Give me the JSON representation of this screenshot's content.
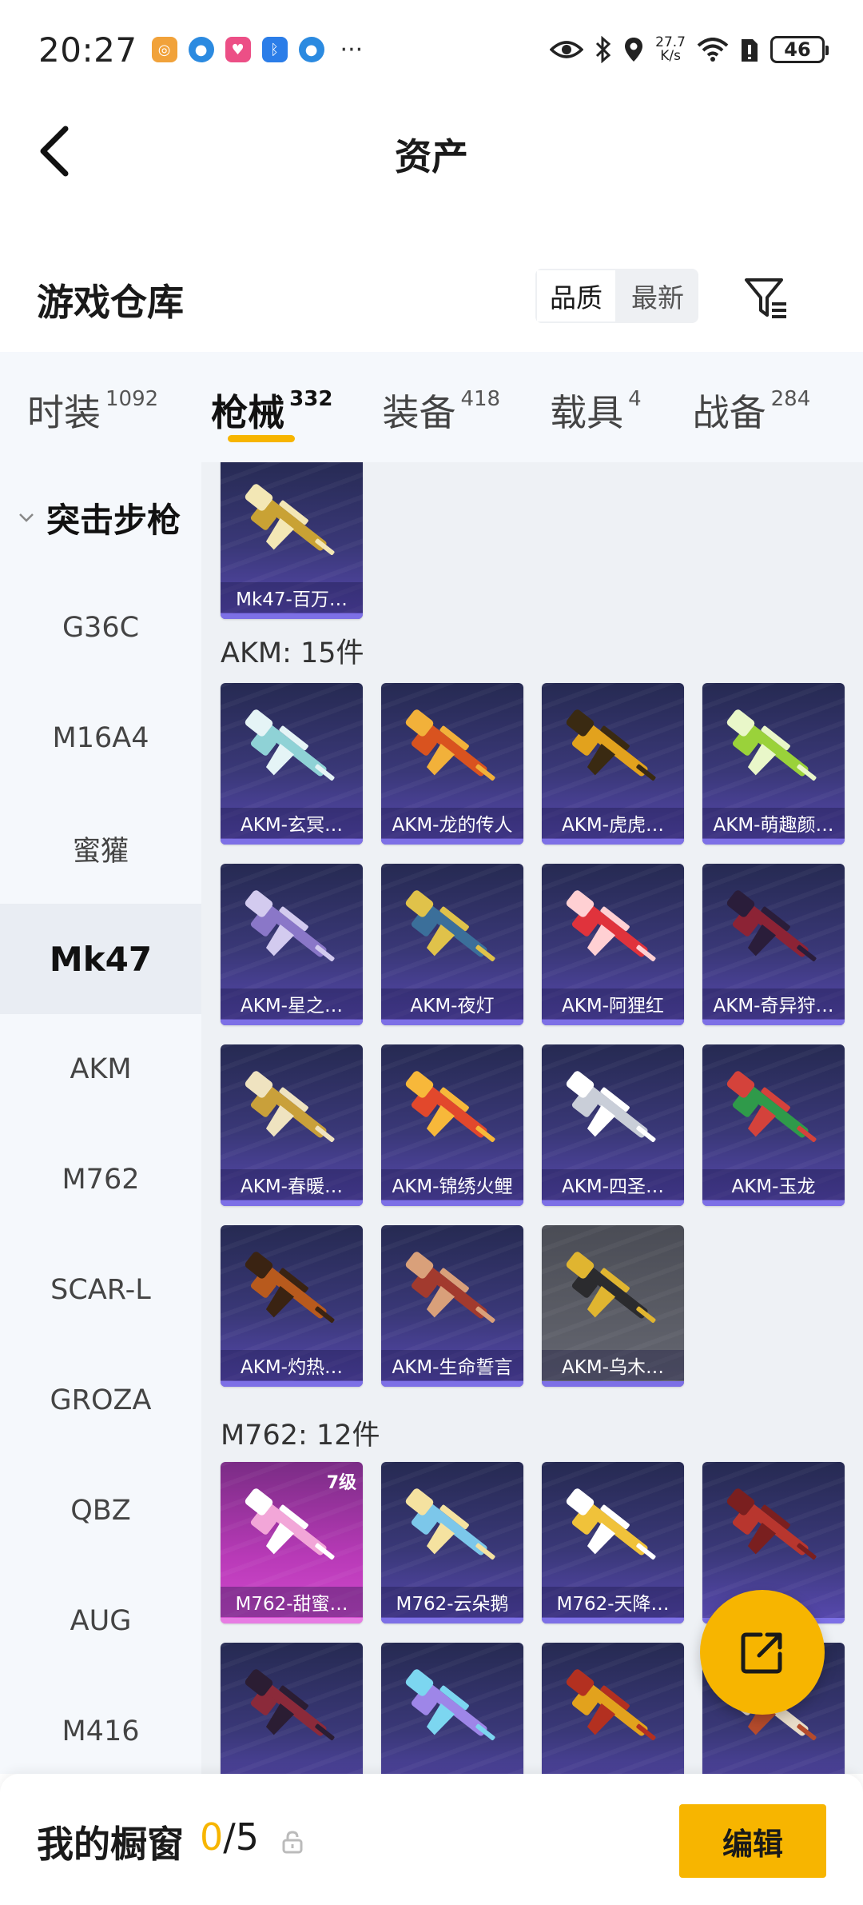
{
  "status_bar": {
    "time": "20:27",
    "net_speed_value": "27.7",
    "net_speed_unit": "K/s",
    "battery": "46",
    "dots": "···"
  },
  "header": {
    "title": "资产"
  },
  "section": {
    "title": "游戏仓库",
    "sort_options": [
      "品质",
      "最新"
    ],
    "active_sort": "品质"
  },
  "tabs": [
    {
      "label": "时装",
      "count": "1092"
    },
    {
      "label": "枪械",
      "count": "332",
      "active": true
    },
    {
      "label": "装备",
      "count": "418"
    },
    {
      "label": "载具",
      "count": "4"
    },
    {
      "label": "战备",
      "count": "284"
    }
  ],
  "categories": {
    "group": "突击步枪",
    "items": [
      "G36C",
      "M16A4",
      "蜜獾",
      "Mk47",
      "AKM",
      "M762",
      "SCAR-L",
      "GROZA",
      "QBZ",
      "AUG",
      "M416"
    ],
    "active": "Mk47"
  },
  "grid": {
    "mk47_cards": [
      {
        "label": "Mk47-百万…",
        "gun": "#c9a234",
        "accent": "#f3e7b5"
      }
    ],
    "akm_group": "AKM: 15件",
    "akm_cards": [
      {
        "label": "AKM-玄冥…",
        "gun": "#8fd2d6",
        "accent": "#e5f4f6"
      },
      {
        "label": "AKM-龙的传人",
        "gun": "#d9531f",
        "accent": "#f2b13a"
      },
      {
        "label": "AKM-虎虎…",
        "gun": "#e2a21d",
        "accent": "#3a2a12"
      },
      {
        "label": "AKM-萌趣颜…",
        "gun": "#9ad23a",
        "accent": "#e9f7c9"
      },
      {
        "label": "AKM-星之…",
        "gun": "#8a77c8",
        "accent": "#d3cbef"
      },
      {
        "label": "AKM-夜灯",
        "gun": "#3b6f9a",
        "accent": "#e0c24a"
      },
      {
        "label": "AKM-阿狸红",
        "gun": "#e0333c",
        "accent": "#ffd0d3"
      },
      {
        "label": "AKM-奇异狩…",
        "gun": "#8c2335",
        "accent": "#2a1d3a"
      },
      {
        "label": "AKM-春暖…",
        "gun": "#c9a03a",
        "accent": "#efe3c0"
      },
      {
        "label": "AKM-锦绣火鲤",
        "gun": "#e2482c",
        "accent": "#f7b83a"
      },
      {
        "label": "AKM-四圣…",
        "gun": "#c9ced8",
        "accent": "#ffffff"
      },
      {
        "label": "AKM-玉龙",
        "gun": "#2f9a4a",
        "accent": "#d4423b"
      },
      {
        "label": "AKM-灼热…",
        "gun": "#b85a1d",
        "accent": "#3a2312"
      },
      {
        "label": "AKM-生命誓言",
        "gun": "#a23a2e",
        "accent": "#d9a07a"
      },
      {
        "label": "AKM-乌木…",
        "gun": "#2b2b2e",
        "accent": "#e0b530"
      }
    ],
    "m762_group": "M762: 12件",
    "m762_cards": [
      {
        "label": "M762-甜蜜…",
        "gun": "#f2a6d8",
        "accent": "#ffffff",
        "level": "7级"
      },
      {
        "label": "M762-云朵鹅",
        "gun": "#7cc7ea",
        "accent": "#f5e2a0"
      },
      {
        "label": "M762-天降…",
        "gun": "#f0c23a",
        "accent": "#ffffff"
      },
      {
        "label": "",
        "gun": "#b8362e",
        "accent": "#7a1f1f"
      },
      {
        "label": "",
        "gun": "#8b2a3a",
        "accent": "#2b1d33"
      },
      {
        "label": "",
        "gun": "#9e86e8",
        "accent": "#7cd6f0"
      },
      {
        "label": "",
        "gun": "#e2a21d",
        "accent": "#b33020"
      },
      {
        "label": "",
        "gun": "#e8dcc8",
        "accent": "#b54b2c"
      }
    ]
  },
  "bottom_bar": {
    "title": "我的橱窗",
    "current": "0",
    "total": "/5",
    "edit_label": "编辑"
  }
}
